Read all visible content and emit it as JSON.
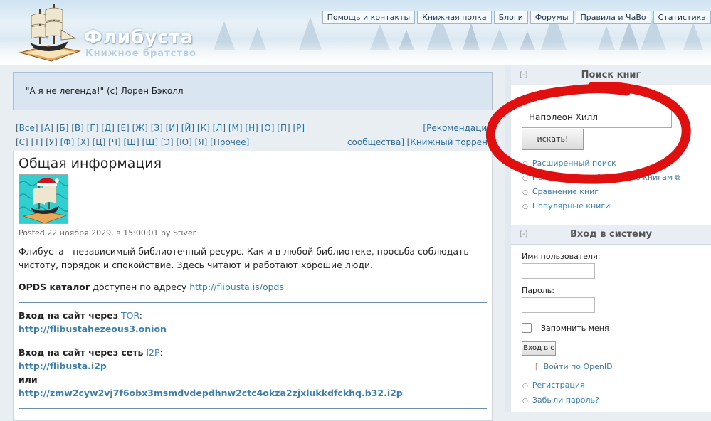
{
  "header": {
    "site_name": "Флибуста",
    "site_slogan": "Книжное братство",
    "nav": [
      "Помощь и контакты",
      "Книжная полка",
      "Блоги",
      "Форумы",
      "Правила и ЧаВо",
      "Статистика"
    ]
  },
  "mission": "\"А я не легенда!\" (с) Лорен Бэколл",
  "alphabet": {
    "row1": [
      "[Все]",
      "[А]",
      "[Б]",
      "[В]",
      "[Г]",
      "[Д]",
      "[Е]",
      "[Ж]",
      "[З]",
      "[И]",
      "[Й]",
      "[К]",
      "[Л]",
      "[М]",
      "[Н]",
      "[О]",
      "[П]",
      "[Р]"
    ],
    "row1_right": "[Рекомендации",
    "row2": [
      "[С]",
      "[Т]",
      "[У]",
      "[Ф]",
      "[Х]",
      "[Ц]",
      "[Ч]",
      "[Ш]",
      "[Щ]",
      "[Э]",
      "[Ю]",
      "[Я]",
      "[Прочее]"
    ],
    "row2_mid": "сообщества]",
    "row2_right": "[Книжный торрент"
  },
  "node": {
    "title": "Общая информация",
    "submitted": "Posted 22 ноября 2029, в 15:00:01 by Stiver",
    "intro": "Флибуста - независимый библиотечный ресурс. Как и в любой библиотеке, просьба соблюдать чистоту, порядок и спокойствие. Здесь читают и работают хорошие люди.",
    "opds_label": "OPDS каталог",
    "opds_text": "доступен по адресу",
    "opds_url": "http://flibusta.is/opds",
    "tor_label": "Вход на сайт через",
    "tor_link": "TOR",
    "tor_url": "http://flibustahezeous3.onion",
    "i2p_label": "Вход на сайт через сеть",
    "i2p_link": "I2P",
    "i2p_url1": "http://flibusta.i2p",
    "or": "или",
    "i2p_url2": "http://zmw2cyw2vj7f6obx3msmdvdepdhnw2ctc4okza2zjxlukkdfckhq.b32.i2p"
  },
  "search_block": {
    "toggle": "[-]",
    "title": "Поиск книг",
    "query": "Наполеон Хилл",
    "button": "искать!",
    "links": [
      "Расширенный поиск",
      "Полнотекстовый поиск по книгам",
      "Сравнение книг",
      "Популярные книги"
    ]
  },
  "login_block": {
    "toggle": "[-]",
    "title": "Вход в систему",
    "username_label": "Имя пользователя:",
    "password_label": "Пароль:",
    "remember": "Запомнить меня",
    "button": "Вход в с",
    "openid": "Войти по OpenID",
    "links": [
      "Регистрация",
      "Забыли пароль?"
    ]
  },
  "colors": {
    "link": "#3a7fb0",
    "annotation": "#e01010",
    "mission_bg": "#d9e6f2"
  }
}
